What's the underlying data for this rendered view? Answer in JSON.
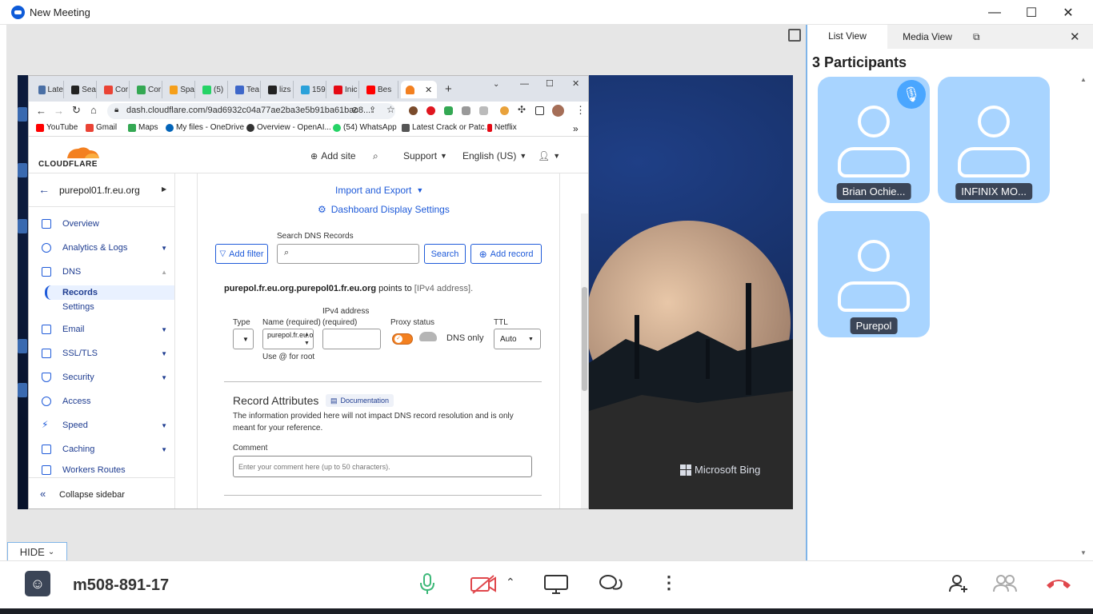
{
  "window": {
    "title": "New Meeting",
    "minimize": "—",
    "maximize": "☐",
    "close": "✕"
  },
  "browser": {
    "tabs": [
      {
        "label": "Late",
        "color": "#4a6fa5"
      },
      {
        "label": "Sea",
        "color": "#222222"
      },
      {
        "label": "Cor",
        "color": "#ea4335"
      },
      {
        "label": "Cor",
        "color": "#34a853"
      },
      {
        "label": "Spa",
        "color": "#f59f1b"
      },
      {
        "label": "(5)",
        "color": "#25d366"
      },
      {
        "label": "Tea",
        "color": "#3e67c9"
      },
      {
        "label": "lizs",
        "color": "#222222"
      },
      {
        "label": "159",
        "color": "#2aa1da"
      },
      {
        "label": "Inic",
        "color": "#e50914"
      },
      {
        "label": "Bes",
        "color": "#ff0000"
      }
    ],
    "active_tab_label": "",
    "new_tab": "+",
    "url": "dash.cloudflare.com/9ad6932c04a77ae2ba3e5b91ba61bac8...",
    "bookmarks": [
      {
        "label": "YouTube",
        "color": "#ff0000"
      },
      {
        "label": "Gmail",
        "color": "#ea4335"
      },
      {
        "label": "Maps",
        "color": "#34a853"
      },
      {
        "label": "My files - OneDrive",
        "color": "#0364b8"
      },
      {
        "label": "Overview - OpenAI...",
        "color": "#333333"
      },
      {
        "label": "(54) WhatsApp",
        "color": "#25d366"
      },
      {
        "label": "Latest Crack or Patc...",
        "color": "#555555"
      },
      {
        "label": "Netflix",
        "color": "#e50914"
      }
    ],
    "bookmarks_more": "»"
  },
  "cloudflare": {
    "logo_text": "CLOUDFLARE",
    "add_site": "Add site",
    "support": "Support",
    "language": "English (US)",
    "domain": "purepol01.fr.eu.org",
    "sidebar": [
      {
        "label": "Overview",
        "caret": ""
      },
      {
        "label": "Analytics & Logs",
        "caret": "▼"
      },
      {
        "label": "DNS",
        "caret": "▲"
      },
      {
        "label": "Email",
        "caret": "▼"
      },
      {
        "label": "SSL/TLS",
        "caret": "▼"
      },
      {
        "label": "Security",
        "caret": "▼"
      },
      {
        "label": "Access",
        "caret": ""
      },
      {
        "label": "Speed",
        "caret": "▼"
      },
      {
        "label": "Caching",
        "caret": "▼"
      },
      {
        "label": "Workers Routes",
        "caret": ""
      }
    ],
    "dns_sub": {
      "records": "Records",
      "settings": "Settings"
    },
    "collapse": "Collapse sidebar",
    "import_export": "Import and Export",
    "display_settings": "Dashboard Display Settings",
    "search_label": "Search DNS Records",
    "add_filter": "Add filter",
    "search_btn": "Search",
    "add_record": "Add record",
    "points_to_name": "purepol.fr.eu.org.purepol01.fr.eu.org",
    "points_to_rest": "points to",
    "points_to_target": "[IPv4 address].",
    "form": {
      "type_label": "Type",
      "name_label": "Name (required)",
      "name_value": "purepol.fr.eu.org",
      "name_hint": "Use @ for root",
      "ipv4_label": "IPv4 address (required)",
      "proxy_label": "Proxy status",
      "proxy_value": "DNS only",
      "ttl_label": "TTL",
      "ttl_value": "Auto"
    },
    "record_attributes": "Record Attributes",
    "documentation": "Documentation",
    "attr_desc": "The information provided here will not impact DNS record resolution and is only meant for your reference.",
    "comment_label": "Comment",
    "comment_placeholder": "Enter your comment here (up to 50 characters)."
  },
  "wallpaper": {
    "bing": "Microsoft Bing"
  },
  "panel": {
    "tab_list": "List View",
    "tab_media": "Media View",
    "heading": "3 Participants",
    "participants": [
      "Brian Ochie...",
      "INFINIX MO...",
      "Purepol"
    ]
  },
  "bottom": {
    "hide": "HIDE",
    "meeting_id": "m508-891-17",
    "colors": {
      "mic": "#3cb878",
      "camera": "#e0474c",
      "hangup": "#e0474c"
    }
  }
}
